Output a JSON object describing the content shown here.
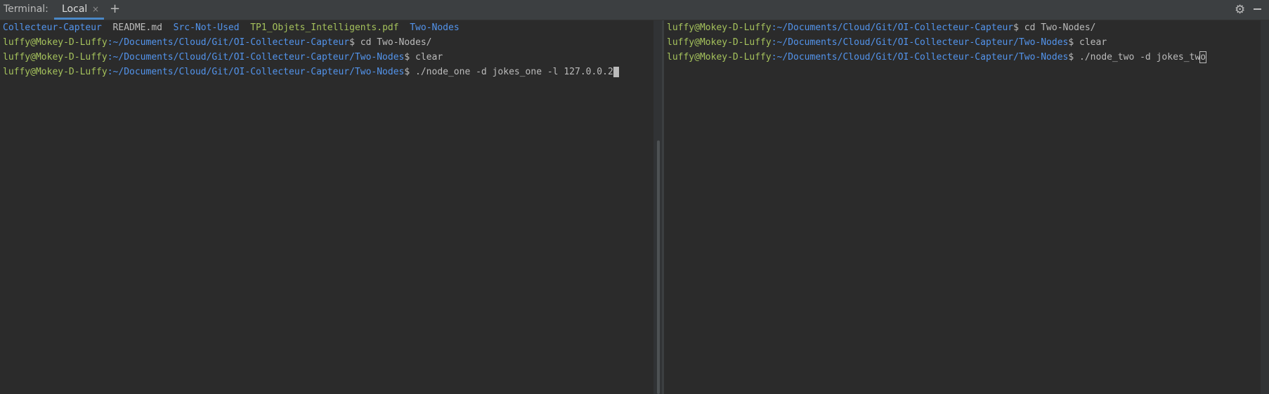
{
  "header": {
    "title": "Terminal:",
    "tab_label": "Local",
    "close_glyph": "×",
    "add_glyph": "+",
    "gear_glyph": "⚙",
    "icons": [
      "close-icon",
      "add-tab-icon",
      "gear-icon",
      "minimize-icon"
    ]
  },
  "left_terminal": {
    "listing": [
      "Collecteur-Capteur",
      "README.md",
      "Src-Not-Used",
      "TP1_Objets_Intelligents.pdf",
      "Two-Nodes"
    ],
    "lines": [
      {
        "user": "luffy@Mokey-D-Luffy",
        "path": ":~/Documents/Cloud/Git/OI-Collecteur-Capteur",
        "command": "$ cd Two-Nodes/"
      },
      {
        "user": "luffy@Mokey-D-Luffy",
        "path": ":~/Documents/Cloud/Git/OI-Collecteur-Capteur/Two-Nodes",
        "command": "$ clear"
      },
      {
        "user": "luffy@Mokey-D-Luffy",
        "path": ":~/Documents/Cloud/Git/OI-Collecteur-Capteur/Two-Nodes",
        "command": "$ ./node_one -d jokes_one -l 127.0.0.2"
      }
    ]
  },
  "right_terminal": {
    "lines": [
      {
        "user": "luffy@Mokey-D-Luffy",
        "path": ":~/Documents/Cloud/Git/OI-Collecteur-Capteur",
        "command": "$ cd Two-Nodes/"
      },
      {
        "user": "luffy@Mokey-D-Luffy",
        "path": ":~/Documents/Cloud/Git/OI-Collecteur-Capteur/Two-Nodes",
        "command": "$ clear"
      },
      {
        "user": "luffy@Mokey-D-Luffy",
        "path": ":~/Documents/Cloud/Git/OI-Collecteur-Capteur/Two-Nodes",
        "command_prefix": "$ ./node_two -d jokes_tw",
        "cursor_char": "o"
      }
    ]
  },
  "colors": {
    "background": "#2b2b2b",
    "header": "#3c3f41",
    "prompt_user": "#a5c25c",
    "prompt_path": "#5394ec",
    "text": "#bbbbbb",
    "tab_underline": "#4a88c7"
  }
}
